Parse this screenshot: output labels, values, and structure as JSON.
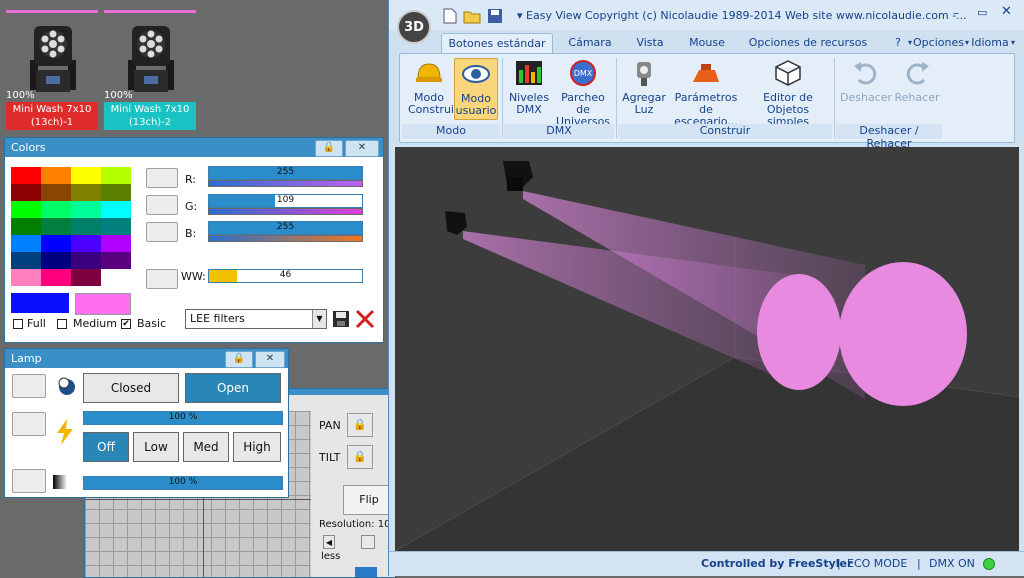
{
  "fixtures": [
    {
      "percent": "100%",
      "label_line1": "Mini Wash 7x10",
      "label_line2": "(13ch)-1",
      "label_color": "#e02b2b"
    },
    {
      "percent": "100%",
      "label_line1": "Mini Wash 7x10",
      "label_line2": "(13ch)-2",
      "label_color": "#19c3c3"
    }
  ],
  "colors_panel": {
    "title": "Colors",
    "palette": [
      [
        "#ff0000",
        "#ff7f00",
        "#ffff00",
        "#b4ff00"
      ],
      [
        "#8b0000",
        "#8b4500",
        "#7f7f00",
        "#5a7f00"
      ],
      [
        "#00ff00",
        "#00ff66",
        "#00ff99",
        "#00ffff"
      ],
      [
        "#007f00",
        "#007f3f",
        "#007f6a",
        "#007f7f"
      ],
      [
        "#0080ff",
        "#0000ff",
        "#4b00ff",
        "#b000ff"
      ],
      [
        "#00407f",
        "#00007f",
        "#3a007f",
        "#5a007f"
      ],
      [
        "#ff7fbf",
        "#ff007f",
        "#7f003f",
        "#ffffff"
      ]
    ],
    "sliders": [
      {
        "label": "R:",
        "value": "255",
        "fraction": 1.0,
        "stripe": "#c060f0"
      },
      {
        "label": "G:",
        "value": "109",
        "fraction": 0.43,
        "stripe": "#e040d8"
      },
      {
        "label": "B:",
        "value": "255",
        "fraction": 1.0,
        "stripe": "#f07820"
      },
      {
        "label": "WW:",
        "value": "46",
        "fraction": 0.18,
        "stripe": ""
      }
    ],
    "preview_primary": "#0a10ff",
    "preview_secondary": "#ff6ff0",
    "options": [
      "Full",
      "Medium",
      "Basic"
    ],
    "basic_checked": true,
    "filter_select": "LEE filters"
  },
  "lamp_panel": {
    "title": "Lamp",
    "closed_label": "Closed",
    "open_label": "Open",
    "dimmer_value": "100 %",
    "levels": [
      "Off",
      "Low",
      "Med",
      "High"
    ],
    "bottom_value": "100 %"
  },
  "bg_window": {
    "pan_label": "PAN",
    "tilt_label": "TILT",
    "flip_label": "Flip",
    "resolution_label": "Resolution: 10",
    "less_label": "less"
  },
  "app": {
    "badge": "3D",
    "title": "Easy View   Copyright (c) Nicolaudie 1989-2014   Web site www.nicolaudie.com -...",
    "tabs": [
      "Botones estándar",
      "Cámara",
      "Vista",
      "Mouse",
      "Opciones de recursos"
    ],
    "right_menu": [
      "?",
      "Opciones",
      "Idioma"
    ],
    "buttons": {
      "modo_construir": [
        "Modo",
        "Construir"
      ],
      "modo_usuario": [
        "Modo",
        "usuario"
      ],
      "niveles_dmx": [
        "Niveles",
        "DMX"
      ],
      "parcheo": [
        "Parcheo de",
        "Universos"
      ],
      "agregar_luz": [
        "Agregar",
        "Luz"
      ],
      "parametros": [
        "Parámetros de",
        "escenario..."
      ],
      "editor": [
        "Editor de",
        "Objetos simples"
      ],
      "deshacer": "Deshacer",
      "rehacer": "Rehacer"
    },
    "groups": [
      "Modo",
      "DMX",
      "Construir",
      "Deshacer / Rehacer"
    ],
    "status": {
      "controlled": "Controlled by FreeStyler",
      "eco": "ECO MODE",
      "dmx": "DMX ON"
    }
  }
}
